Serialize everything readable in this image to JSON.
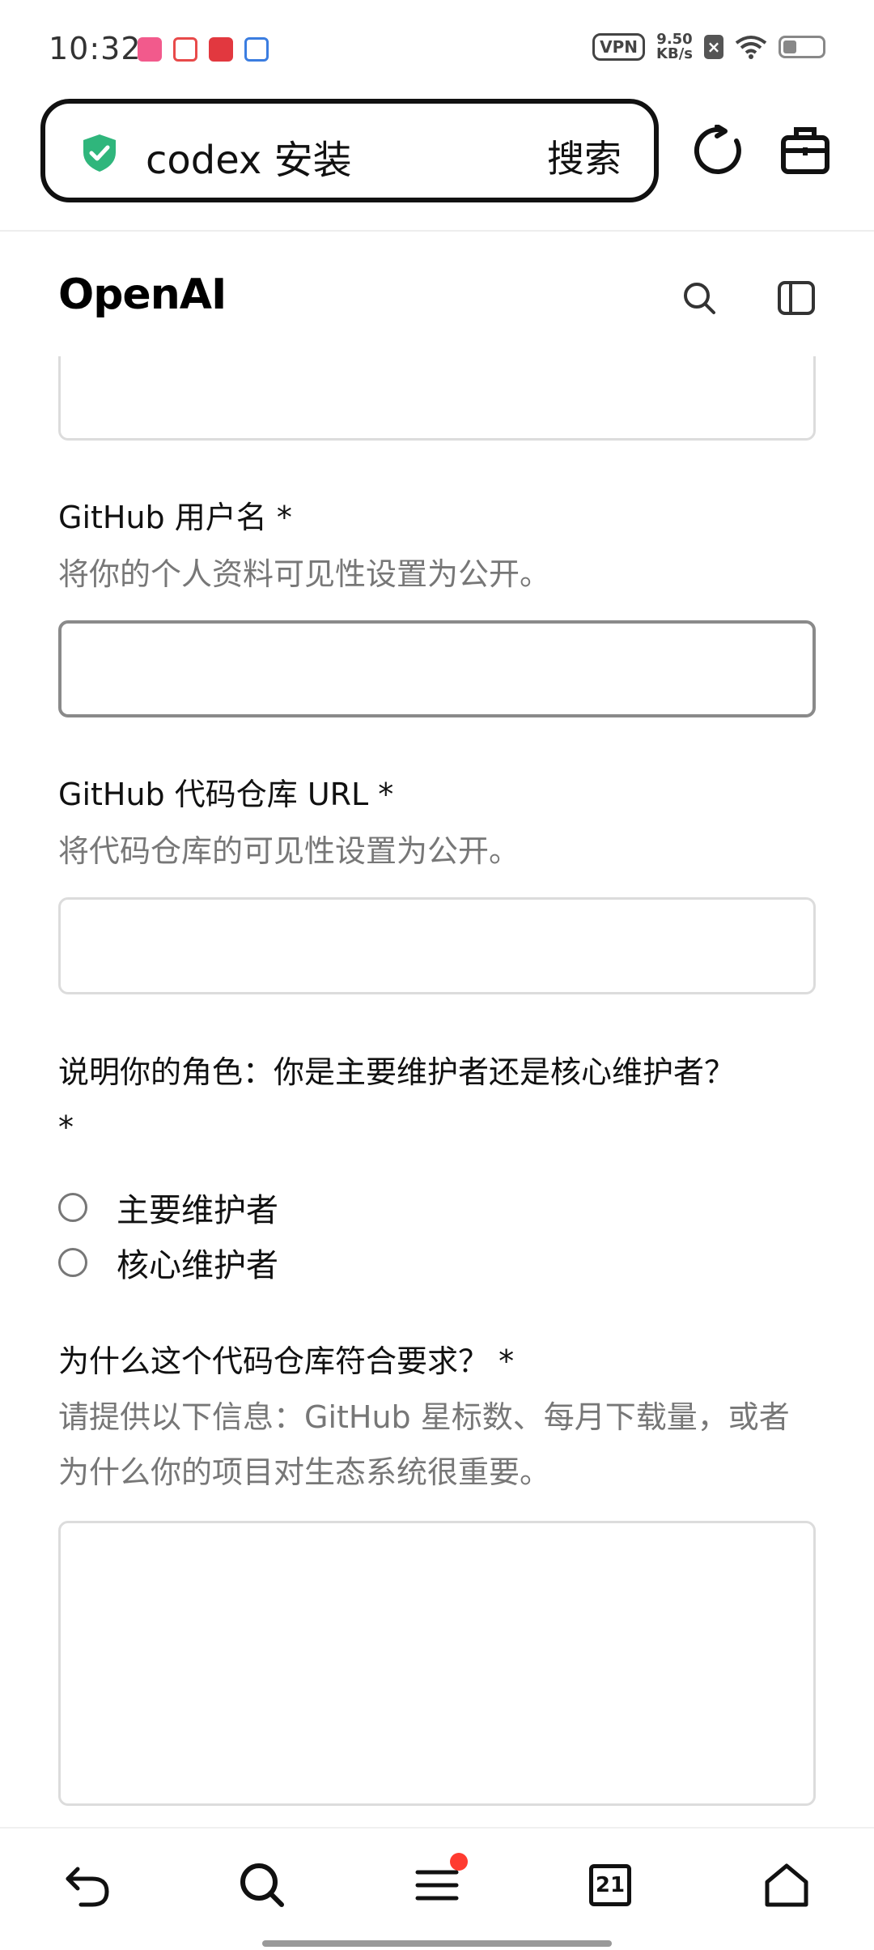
{
  "status_bar": {
    "time": "10:32",
    "vpn": "VPN",
    "speed_value": "9.50",
    "speed_unit": "KB/s"
  },
  "browser": {
    "search_query": "codex 安装",
    "search_button": "搜索"
  },
  "site": {
    "logo": "OpenAI"
  },
  "form": {
    "github_username": {
      "label": "GitHub 用户名 *",
      "help": "将你的个人资料可见性设置为公开。",
      "value": ""
    },
    "repo_url": {
      "label": "GitHub 代码仓库 URL *",
      "help": "将代码仓库的可见性设置为公开。",
      "value": ""
    },
    "role": {
      "label": "说明你的角色：你是主要维护者还是核心维护者？ *",
      "options": [
        "主要维护者",
        "核心维护者"
      ]
    },
    "why": {
      "label": "为什么这个代码仓库符合要求？ *",
      "help": "请提供以下信息：GitHub 星标数、每月下载量，或者为什么你的项目对生态系统很重要。",
      "value": ""
    }
  },
  "bottom_nav": {
    "tab_count": "21"
  },
  "colors": {
    "shield": "#2fb67c",
    "notification_dot": "#ff3b30",
    "help_text": "#777777"
  }
}
